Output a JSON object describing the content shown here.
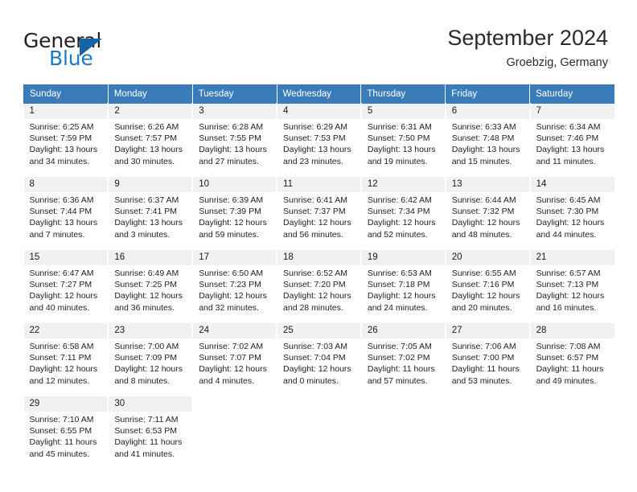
{
  "brand": {
    "name_top": "General",
    "name_bottom": "Blue",
    "triangle_color": "#1763a5",
    "blue_color": "#1f7ac0"
  },
  "header": {
    "title": "September 2024",
    "subtitle": "Groebzig, Germany",
    "accent_color": "#3a7cb9",
    "daynum_bg": "#f1f1f1"
  },
  "weekday_headers": [
    "Sunday",
    "Monday",
    "Tuesday",
    "Wednesday",
    "Thursday",
    "Friday",
    "Saturday"
  ],
  "labels": {
    "sunrise_prefix": "Sunrise:",
    "sunset_prefix": "Sunset:",
    "daylight_prefix": "Daylight:"
  },
  "weeks": [
    [
      {
        "day": "1",
        "sunrise": "Sunrise: 6:25 AM",
        "sunset": "Sunset: 7:59 PM",
        "daylight1": "Daylight: 13 hours",
        "daylight2": "and 34 minutes."
      },
      {
        "day": "2",
        "sunrise": "Sunrise: 6:26 AM",
        "sunset": "Sunset: 7:57 PM",
        "daylight1": "Daylight: 13 hours",
        "daylight2": "and 30 minutes."
      },
      {
        "day": "3",
        "sunrise": "Sunrise: 6:28 AM",
        "sunset": "Sunset: 7:55 PM",
        "daylight1": "Daylight: 13 hours",
        "daylight2": "and 27 minutes."
      },
      {
        "day": "4",
        "sunrise": "Sunrise: 6:29 AM",
        "sunset": "Sunset: 7:53 PM",
        "daylight1": "Daylight: 13 hours",
        "daylight2": "and 23 minutes."
      },
      {
        "day": "5",
        "sunrise": "Sunrise: 6:31 AM",
        "sunset": "Sunset: 7:50 PM",
        "daylight1": "Daylight: 13 hours",
        "daylight2": "and 19 minutes."
      },
      {
        "day": "6",
        "sunrise": "Sunrise: 6:33 AM",
        "sunset": "Sunset: 7:48 PM",
        "daylight1": "Daylight: 13 hours",
        "daylight2": "and 15 minutes."
      },
      {
        "day": "7",
        "sunrise": "Sunrise: 6:34 AM",
        "sunset": "Sunset: 7:46 PM",
        "daylight1": "Daylight: 13 hours",
        "daylight2": "and 11 minutes."
      }
    ],
    [
      {
        "day": "8",
        "sunrise": "Sunrise: 6:36 AM",
        "sunset": "Sunset: 7:44 PM",
        "daylight1": "Daylight: 13 hours",
        "daylight2": "and 7 minutes."
      },
      {
        "day": "9",
        "sunrise": "Sunrise: 6:37 AM",
        "sunset": "Sunset: 7:41 PM",
        "daylight1": "Daylight: 13 hours",
        "daylight2": "and 3 minutes."
      },
      {
        "day": "10",
        "sunrise": "Sunrise: 6:39 AM",
        "sunset": "Sunset: 7:39 PM",
        "daylight1": "Daylight: 12 hours",
        "daylight2": "and 59 minutes."
      },
      {
        "day": "11",
        "sunrise": "Sunrise: 6:41 AM",
        "sunset": "Sunset: 7:37 PM",
        "daylight1": "Daylight: 12 hours",
        "daylight2": "and 56 minutes."
      },
      {
        "day": "12",
        "sunrise": "Sunrise: 6:42 AM",
        "sunset": "Sunset: 7:34 PM",
        "daylight1": "Daylight: 12 hours",
        "daylight2": "and 52 minutes."
      },
      {
        "day": "13",
        "sunrise": "Sunrise: 6:44 AM",
        "sunset": "Sunset: 7:32 PM",
        "daylight1": "Daylight: 12 hours",
        "daylight2": "and 48 minutes."
      },
      {
        "day": "14",
        "sunrise": "Sunrise: 6:45 AM",
        "sunset": "Sunset: 7:30 PM",
        "daylight1": "Daylight: 12 hours",
        "daylight2": "and 44 minutes."
      }
    ],
    [
      {
        "day": "15",
        "sunrise": "Sunrise: 6:47 AM",
        "sunset": "Sunset: 7:27 PM",
        "daylight1": "Daylight: 12 hours",
        "daylight2": "and 40 minutes."
      },
      {
        "day": "16",
        "sunrise": "Sunrise: 6:49 AM",
        "sunset": "Sunset: 7:25 PM",
        "daylight1": "Daylight: 12 hours",
        "daylight2": "and 36 minutes."
      },
      {
        "day": "17",
        "sunrise": "Sunrise: 6:50 AM",
        "sunset": "Sunset: 7:23 PM",
        "daylight1": "Daylight: 12 hours",
        "daylight2": "and 32 minutes."
      },
      {
        "day": "18",
        "sunrise": "Sunrise: 6:52 AM",
        "sunset": "Sunset: 7:20 PM",
        "daylight1": "Daylight: 12 hours",
        "daylight2": "and 28 minutes."
      },
      {
        "day": "19",
        "sunrise": "Sunrise: 6:53 AM",
        "sunset": "Sunset: 7:18 PM",
        "daylight1": "Daylight: 12 hours",
        "daylight2": "and 24 minutes."
      },
      {
        "day": "20",
        "sunrise": "Sunrise: 6:55 AM",
        "sunset": "Sunset: 7:16 PM",
        "daylight1": "Daylight: 12 hours",
        "daylight2": "and 20 minutes."
      },
      {
        "day": "21",
        "sunrise": "Sunrise: 6:57 AM",
        "sunset": "Sunset: 7:13 PM",
        "daylight1": "Daylight: 12 hours",
        "daylight2": "and 16 minutes."
      }
    ],
    [
      {
        "day": "22",
        "sunrise": "Sunrise: 6:58 AM",
        "sunset": "Sunset: 7:11 PM",
        "daylight1": "Daylight: 12 hours",
        "daylight2": "and 12 minutes."
      },
      {
        "day": "23",
        "sunrise": "Sunrise: 7:00 AM",
        "sunset": "Sunset: 7:09 PM",
        "daylight1": "Daylight: 12 hours",
        "daylight2": "and 8 minutes."
      },
      {
        "day": "24",
        "sunrise": "Sunrise: 7:02 AM",
        "sunset": "Sunset: 7:07 PM",
        "daylight1": "Daylight: 12 hours",
        "daylight2": "and 4 minutes."
      },
      {
        "day": "25",
        "sunrise": "Sunrise: 7:03 AM",
        "sunset": "Sunset: 7:04 PM",
        "daylight1": "Daylight: 12 hours",
        "daylight2": "and 0 minutes."
      },
      {
        "day": "26",
        "sunrise": "Sunrise: 7:05 AM",
        "sunset": "Sunset: 7:02 PM",
        "daylight1": "Daylight: 11 hours",
        "daylight2": "and 57 minutes."
      },
      {
        "day": "27",
        "sunrise": "Sunrise: 7:06 AM",
        "sunset": "Sunset: 7:00 PM",
        "daylight1": "Daylight: 11 hours",
        "daylight2": "and 53 minutes."
      },
      {
        "day": "28",
        "sunrise": "Sunrise: 7:08 AM",
        "sunset": "Sunset: 6:57 PM",
        "daylight1": "Daylight: 11 hours",
        "daylight2": "and 49 minutes."
      }
    ],
    [
      {
        "day": "29",
        "sunrise": "Sunrise: 7:10 AM",
        "sunset": "Sunset: 6:55 PM",
        "daylight1": "Daylight: 11 hours",
        "daylight2": "and 45 minutes."
      },
      {
        "day": "30",
        "sunrise": "Sunrise: 7:11 AM",
        "sunset": "Sunset: 6:53 PM",
        "daylight1": "Daylight: 11 hours",
        "daylight2": "and 41 minutes."
      },
      {
        "day": "",
        "sunrise": "",
        "sunset": "",
        "daylight1": "",
        "daylight2": ""
      },
      {
        "day": "",
        "sunrise": "",
        "sunset": "",
        "daylight1": "",
        "daylight2": ""
      },
      {
        "day": "",
        "sunrise": "",
        "sunset": "",
        "daylight1": "",
        "daylight2": ""
      },
      {
        "day": "",
        "sunrise": "",
        "sunset": "",
        "daylight1": "",
        "daylight2": ""
      },
      {
        "day": "",
        "sunrise": "",
        "sunset": "",
        "daylight1": "",
        "daylight2": ""
      }
    ]
  ]
}
